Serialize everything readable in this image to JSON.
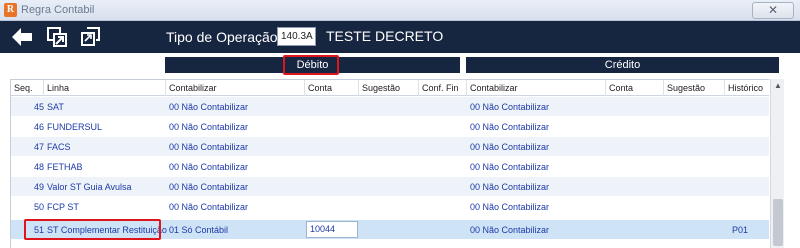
{
  "window": {
    "title": "Regra Contabil",
    "close_glyph": "✕",
    "app_glyph": "R"
  },
  "toolbar": {
    "back_icon": "back-arrow-icon",
    "export_icon": "export-icon",
    "copy_icon": "copy-icon",
    "operation_label": "Tipo de Operação",
    "operation_code": "140.3A",
    "operation_desc": "TESTE DECRETO"
  },
  "sections": {
    "debito": "Débito",
    "credito": "Crédito"
  },
  "columns": {
    "seq": "Seq.",
    "linha": "Linha",
    "d_contabilizar": "Contabilizar",
    "d_conta": "Conta",
    "d_sugestao": "Sugestão",
    "d_conf_fin": "Conf. Fin",
    "c_contabilizar": "Contabilizar",
    "c_conta": "Conta",
    "c_sugestao": "Sugestão",
    "c_historico": "Histórico"
  },
  "rows": [
    {
      "seq": "45",
      "linha": "SAT",
      "d_contabilizar": "00 Não Contabilizar",
      "c_contabilizar": "00 Não Contabilizar"
    },
    {
      "seq": "46",
      "linha": "FUNDERSUL",
      "d_contabilizar": "00 Não Contabilizar",
      "c_contabilizar": "00 Não Contabilizar"
    },
    {
      "seq": "47",
      "linha": "FACS",
      "d_contabilizar": "00 Não Contabilizar",
      "c_contabilizar": "00 Não Contabilizar"
    },
    {
      "seq": "48",
      "linha": "FETHAB",
      "d_contabilizar": "00 Não Contabilizar",
      "c_contabilizar": "00 Não Contabilizar"
    },
    {
      "seq": "49",
      "linha": "Valor ST Guia Avulsa",
      "d_contabilizar": "00 Não Contabilizar",
      "c_contabilizar": "00 Não Contabilizar"
    },
    {
      "seq": "50",
      "linha": "FCP ST",
      "d_contabilizar": "00 Não Contabilizar",
      "c_contabilizar": "00 Não Contabilizar"
    },
    {
      "seq": "51",
      "linha": "ST Complementar Restituição",
      "d_contabilizar": "01 Só Contábil",
      "d_conta": "10044",
      "c_contabilizar": "00 Não Contabilizar",
      "c_historico": "P01"
    }
  ],
  "scrollbar": {
    "up_glyph": "▲"
  },
  "colors": {
    "toolbar_bg": "#162540",
    "row_text": "#1c3aa8",
    "selected_row": "#cfe3f6",
    "highlight_box": "#e0141b"
  }
}
